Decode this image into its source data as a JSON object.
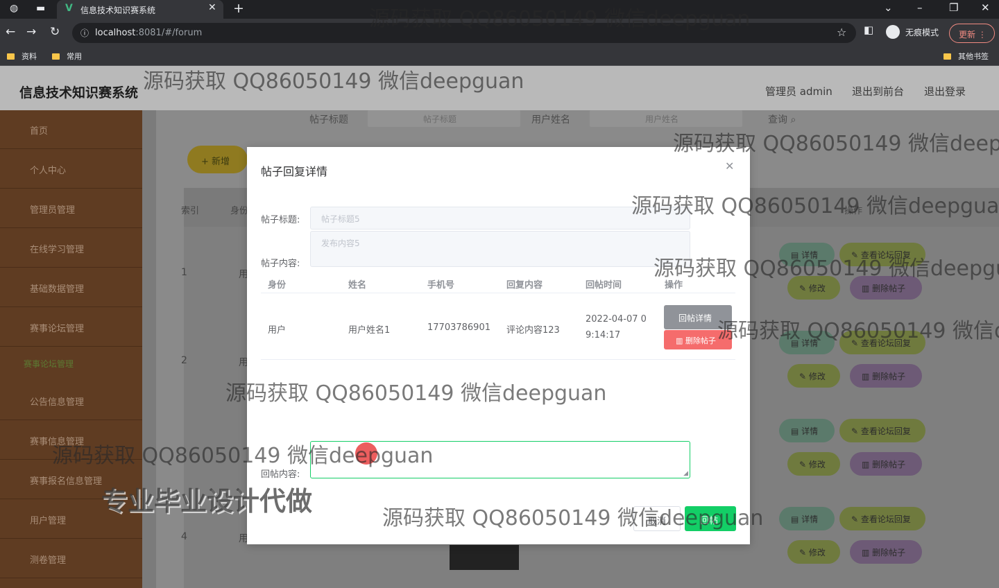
{
  "browser": {
    "tab_title": "信息技术知识赛系统",
    "tab_logo": "V",
    "url_host": "localhost",
    "url_rest": ":8081/#/forum",
    "incognito_label": "无痕模式",
    "update_label": "更新",
    "bookmarks": [
      "资料",
      "常用"
    ],
    "other_bookmarks": "其他书签"
  },
  "header": {
    "title": "信息技术知识赛系统",
    "user": "管理员 admin",
    "back_front": "退出到前台",
    "logout": "退出登录"
  },
  "sidebar": {
    "items": [
      "首页",
      "个人中心",
      "管理员管理",
      "在线学习管理",
      "基础数据管理",
      "赛事论坛管理",
      "公告信息管理",
      "赛事信息管理",
      "赛事报名信息管理",
      "用户管理",
      "测卷管理"
    ],
    "sub_item": "赛事论坛管理"
  },
  "search": {
    "title_label": "帖子标题",
    "title_placeholder": "帖子标题",
    "user_label": "用户姓名",
    "user_placeholder": "用户姓名",
    "query": "查询"
  },
  "toolbar": {
    "add": "新增"
  },
  "table": {
    "headers": [
      "索引",
      "身份",
      "操作"
    ],
    "row_index": [
      "1",
      "2",
      "4"
    ],
    "row_role_prefix": "用",
    "ops": {
      "detail": "详情",
      "view_reply": "查看论坛回复",
      "edit": "修改",
      "delete": "删除帖子"
    }
  },
  "modal": {
    "title": "帖子回复详情",
    "post_title_label": "帖子标题:",
    "post_title_value": "帖子标题5",
    "post_content_label": "帖子内容:",
    "post_content_value": "发布内容5",
    "reply_headers": [
      "身份",
      "姓名",
      "手机号",
      "回复内容",
      "回帖时间",
      "操作"
    ],
    "reply_row": {
      "role": "用户",
      "name": "用户姓名1",
      "phone": "17703786901",
      "content": "评论内容123",
      "time_line1": "2022-04-07 0",
      "time_line2": "9:14:17",
      "detail_btn": "回帖详情",
      "delete_btn": "删除帖子"
    },
    "reply_label": "回帖内容:",
    "cancel": "取消",
    "ok": "回帖"
  },
  "watermarks": {
    "text": "源码获取 QQ86050149 微信deepguan",
    "big": "专业毕业设计代做"
  },
  "colors": {
    "accent": "#13ce66",
    "danger": "#f56c6c",
    "sidebar": "#5f3c22"
  }
}
